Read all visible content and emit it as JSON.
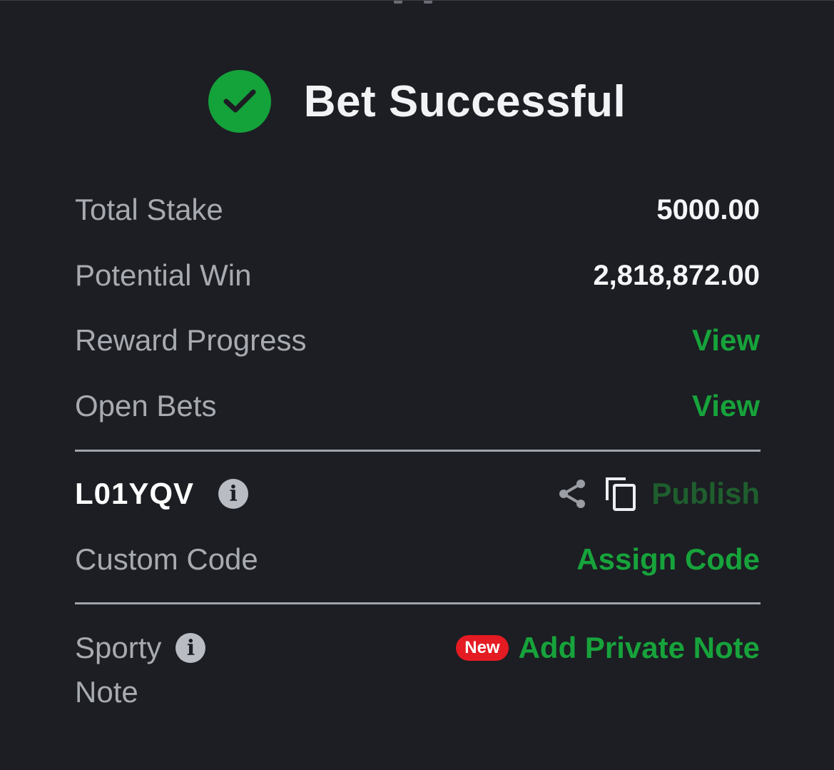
{
  "header": {
    "title": "Bet Successful"
  },
  "summary": {
    "total_stake_label": "Total Stake",
    "total_stake_value": "5000.00",
    "potential_win_label": "Potential Win",
    "potential_win_value": "2,818,872.00",
    "reward_progress_label": "Reward Progress",
    "reward_progress_link": "View",
    "open_bets_label": "Open Bets",
    "open_bets_link": "View"
  },
  "booking": {
    "code": "L01YQV",
    "publish_label": "Publish",
    "custom_code_label": "Custom Code",
    "assign_code_label": "Assign Code"
  },
  "note": {
    "label_line1": "Sporty",
    "label_line2": "Note",
    "badge": "New",
    "add_note_label": "Add Private Note"
  },
  "icons": {
    "success": "check-circle-icon",
    "info": "info-icon",
    "share": "share-icon",
    "copy": "copy-icon"
  },
  "colors": {
    "background": "#1c1e23",
    "accent_green": "#17a33b",
    "publish_green": "#1f5e2e",
    "badge_red": "#e41b23"
  }
}
